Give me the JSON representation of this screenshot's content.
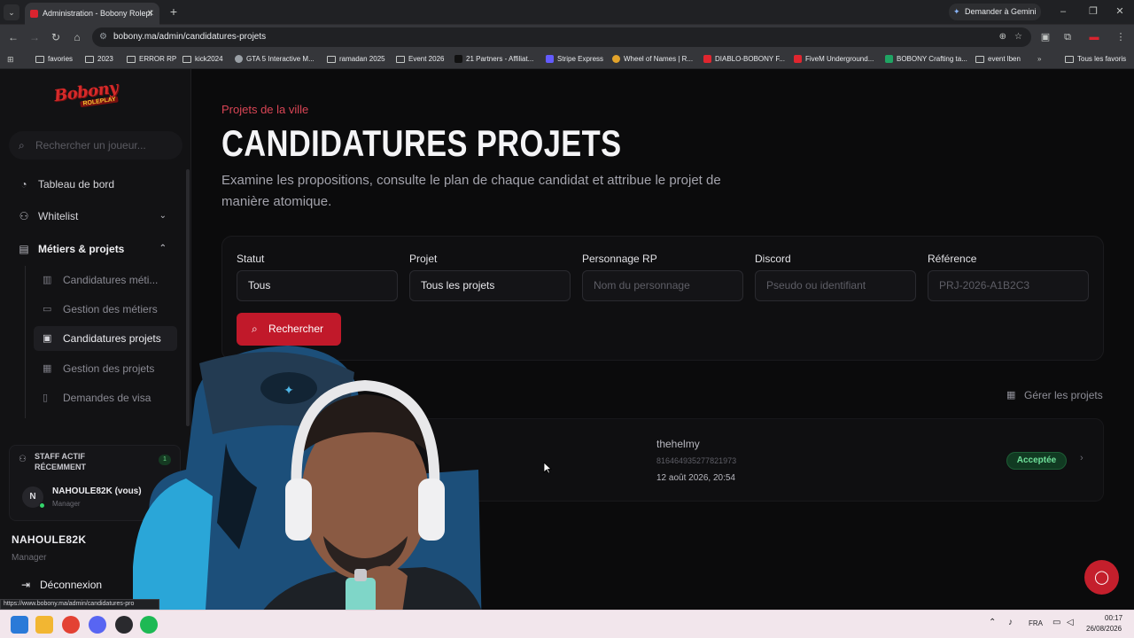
{
  "browser": {
    "tab_title": "Administration - Bobony Rolepl",
    "gemini_label": "Demander à Gemini",
    "url": "bobony.ma/admin/candidatures-projets",
    "bookmarks": [
      "favories",
      "2023",
      "ERROR RP",
      "kick2024",
      "GTA 5 Interactive M...",
      "ramadan 2025",
      "Event 2026",
      "21 Partners - Affiliat...",
      "Stripe Express",
      "Wheel of Names | R...",
      "DIABLO-BOBONY F...",
      "FiveM Underground...",
      "BOBONY Crafting ta...",
      "event lben"
    ],
    "all_bookmarks": "Tous les favoris",
    "more": "»"
  },
  "sidebar": {
    "logo_main": "Bobony",
    "logo_sub": "ROLEPLAY",
    "search_placeholder": "Rechercher un joueur...",
    "dashboard": "Tableau de bord",
    "whitelist": "Whitelist",
    "jobs_projects": "Métiers & projets",
    "items": [
      {
        "label": "Candidatures méti..."
      },
      {
        "label": "Gestion des métiers"
      },
      {
        "label": "Candidatures projets"
      },
      {
        "label": "Gestion des projets"
      },
      {
        "label": "Demandes de visa"
      }
    ],
    "staff_title": "STAFF ACTIF RÉCEMMENT",
    "staff_count": "1",
    "staff_avatar": "N",
    "staff_name": "NAHOULE82K (vous)",
    "staff_role": "Manager",
    "user_name": "NAHOULE82K",
    "user_role": "Manager",
    "logout": "Déconnexion"
  },
  "main": {
    "eyebrow": "Projets de la ville",
    "title": "CANDIDATURES PROJETS",
    "description": "Examine les propositions, consulte le plan de chaque candidat et attribue le projet de manière atomique.",
    "filters": {
      "status_label": "Statut",
      "status_value": "Tous",
      "project_label": "Projet",
      "project_value": "Tous les projets",
      "character_label": "Personnage RP",
      "character_placeholder": "Nom du personnage",
      "discord_label": "Discord",
      "discord_placeholder": "Pseudo ou identifiant",
      "reference_label": "Référence",
      "reference_placeholder": "PRJ-2026-A1B2C3",
      "search_button": "Rechercher"
    },
    "manage_link": "Gérer les projets",
    "rows": [
      {
        "discord": "thehelmy",
        "discord_id": "816464935277821973",
        "date": "12 août 2026, 20:54",
        "status": "Acceptée",
        "status_color": "#6fe09a"
      }
    ]
  },
  "status_url": "https://www.bobony.ma/admin/candidatures-pro",
  "tray": {
    "lang": "FRA",
    "time": "00:17",
    "date": "26/08/2026"
  },
  "colors": {
    "accent": "#c1192a",
    "accent_text": "#d94555",
    "success": "#6fe09a"
  }
}
